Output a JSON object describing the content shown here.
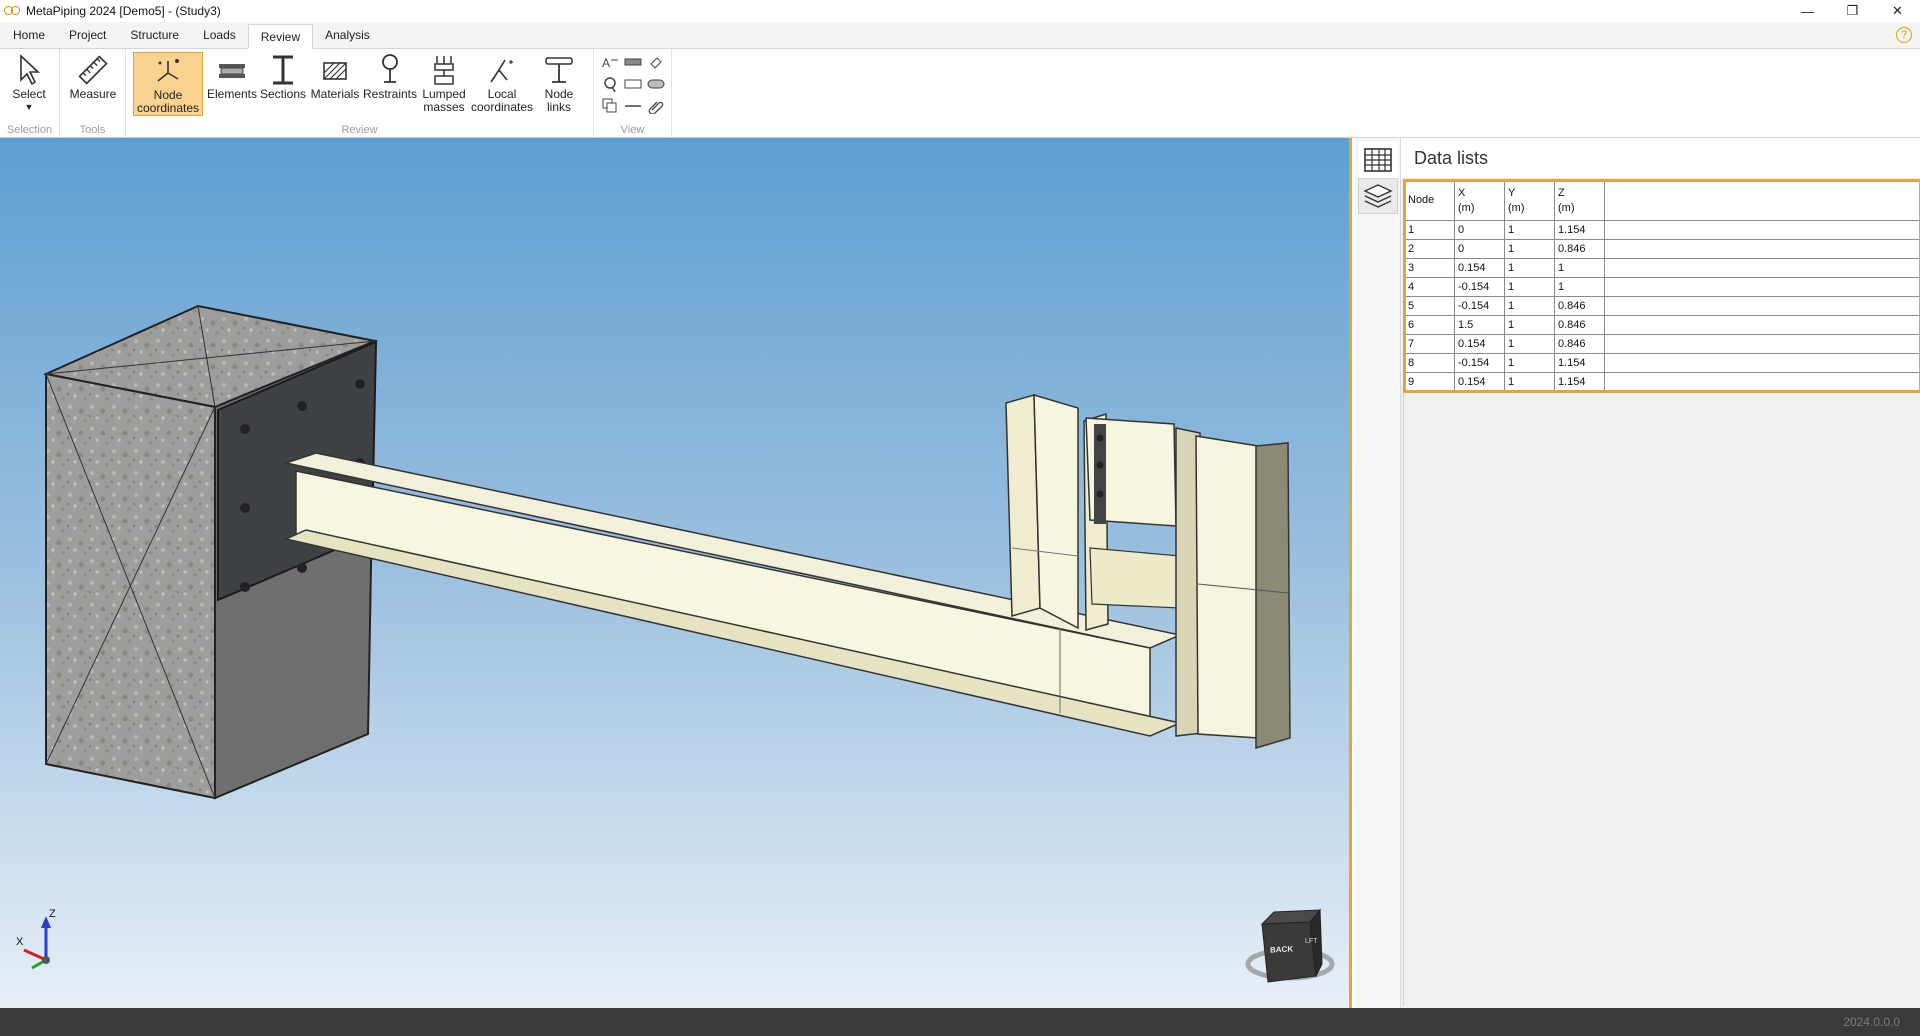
{
  "window": {
    "title": "MetaPiping 2024 [Demo5] - (Study3)",
    "minimize": "—",
    "restore": "❐",
    "close": "✕"
  },
  "menu": {
    "tabs": [
      "Home",
      "Project",
      "Structure",
      "Loads",
      "Review",
      "Analysis"
    ],
    "active": "Review",
    "help": "?"
  },
  "ribbon": {
    "selection": {
      "label": "Selection",
      "select": "Select"
    },
    "tools": {
      "label": "Tools",
      "measure": "Measure"
    },
    "review": {
      "label": "Review",
      "node_coordinates_l1": "Node",
      "node_coordinates_l2": "coordinates",
      "elements": "Elements",
      "sections": "Sections",
      "materials": "Materials",
      "restraints": "Restraints",
      "lumped_l1": "Lumped",
      "lumped_l2": "masses",
      "local_l1": "Local",
      "local_l2": "coordinates",
      "nodelinks_l1": "Node",
      "nodelinks_l2": "links"
    },
    "view": {
      "label": "View"
    }
  },
  "viewport": {
    "axis_z": "Z",
    "axis_x": "X",
    "cube_back": "BACK",
    "cube_left": "LFT"
  },
  "panel": {
    "title": "Data lists",
    "columns": [
      {
        "name": "Node",
        "unit": ""
      },
      {
        "name": "X",
        "unit": "(m)"
      },
      {
        "name": "Y",
        "unit": "(m)"
      },
      {
        "name": "Z",
        "unit": "(m)"
      }
    ],
    "rows": [
      [
        "1",
        "0",
        "1",
        "1.154"
      ],
      [
        "2",
        "0",
        "1",
        "0.846"
      ],
      [
        "3",
        "0.154",
        "1",
        "1"
      ],
      [
        "4",
        "-0.154",
        "1",
        "1"
      ],
      [
        "5",
        "-0.154",
        "1",
        "0.846"
      ],
      [
        "6",
        "1.5",
        "1",
        "0.846"
      ],
      [
        "7",
        "0.154",
        "1",
        "0.846"
      ],
      [
        "8",
        "-0.154",
        "1",
        "1.154"
      ],
      [
        "9",
        "0.154",
        "1",
        "1.154"
      ]
    ]
  },
  "status": {
    "version": "2024.0.0.0"
  },
  "colors": {
    "accent": "#e3a43c",
    "active_button": "#fbd391",
    "statusbar": "#3b3b3b"
  }
}
